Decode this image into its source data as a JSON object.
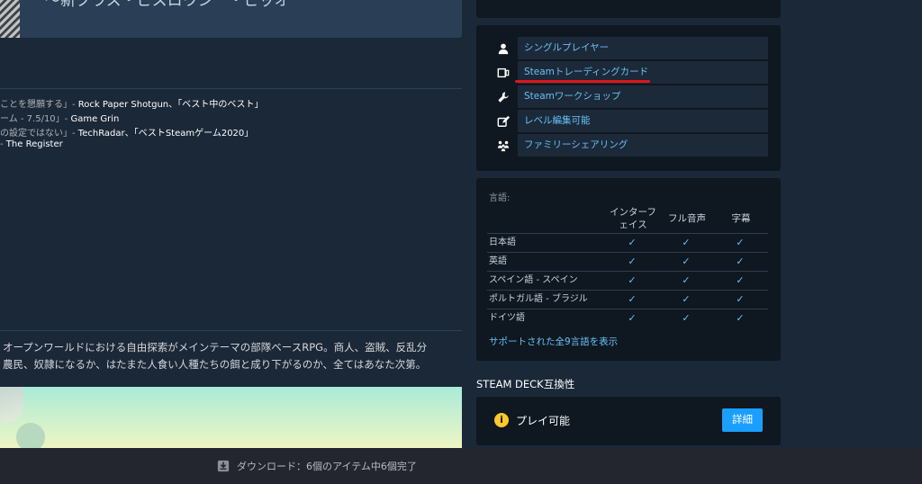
{
  "hero": {
    "title": "〜新クラス・ビスロウシー・ビッオ"
  },
  "reviews": [
    {
      "quote": "ことを懇願する」- ",
      "source": "Rock Paper Shotgun、「ベスト中のベスト」"
    },
    {
      "quote": "ーム - 7.5/10」- ",
      "source": "Game Grin"
    },
    {
      "quote": "の設定ではない」- ",
      "source": "TechRadar、「ベストSteamゲーム2020」"
    },
    {
      "quote": "- ",
      "source": "The Register"
    }
  ],
  "description": {
    "line1": "オープンワールドにおける自由探索がメインテーマの部隊ベースRPG。商人、盗賊、反乱分",
    "line2": "農民、奴隷になるか、はたまた人食い人種たちの餌と成り下がるのか、全てはあなた次第。"
  },
  "features": [
    {
      "icon": "person-icon",
      "label": "シングルプレイヤー"
    },
    {
      "icon": "trading-card-icon",
      "label": "Steamトレーディングカード"
    },
    {
      "icon": "wrench-icon",
      "label": "Steamワークショップ"
    },
    {
      "icon": "edit-icon",
      "label": "レベル編集可能"
    },
    {
      "icon": "family-icon",
      "label": "ファミリーシェアリング"
    }
  ],
  "languages": {
    "title": "言語:",
    "headers": {
      "interface_l1": "インターフ",
      "interface_l2": "ェイス",
      "audio": "フル音声",
      "subtitles": "字幕"
    },
    "rows": [
      {
        "name": "日本語",
        "interface": "✓",
        "audio": "✓",
        "subtitles": "✓"
      },
      {
        "name": "英語",
        "interface": "✓",
        "audio": "✓",
        "subtitles": "✓"
      },
      {
        "name": "スペイン語 - スペイン",
        "interface": "✓",
        "audio": "✓",
        "subtitles": "✓"
      },
      {
        "name": "ポルトガル語 - ブラジル",
        "interface": "✓",
        "audio": "✓",
        "subtitles": "✓"
      },
      {
        "name": "ドイツ語",
        "interface": "✓",
        "audio": "✓",
        "subtitles": "✓"
      }
    ],
    "more_link": "サポートされた全9言語を表示"
  },
  "deck": {
    "title": "STEAM DECK互換性",
    "status_icon": "i",
    "status": "プレイ可能",
    "details_button": "詳細"
  },
  "download_bar": {
    "text": "ダウンロード：6個のアイテム中6個完了"
  },
  "colors": {
    "background": "#1b2838",
    "panel": "#0f1720",
    "link": "#67c1f5",
    "highlight_underline": "#e0161c",
    "deck_button": "#1a9fff",
    "warning": "#ffc82c"
  }
}
